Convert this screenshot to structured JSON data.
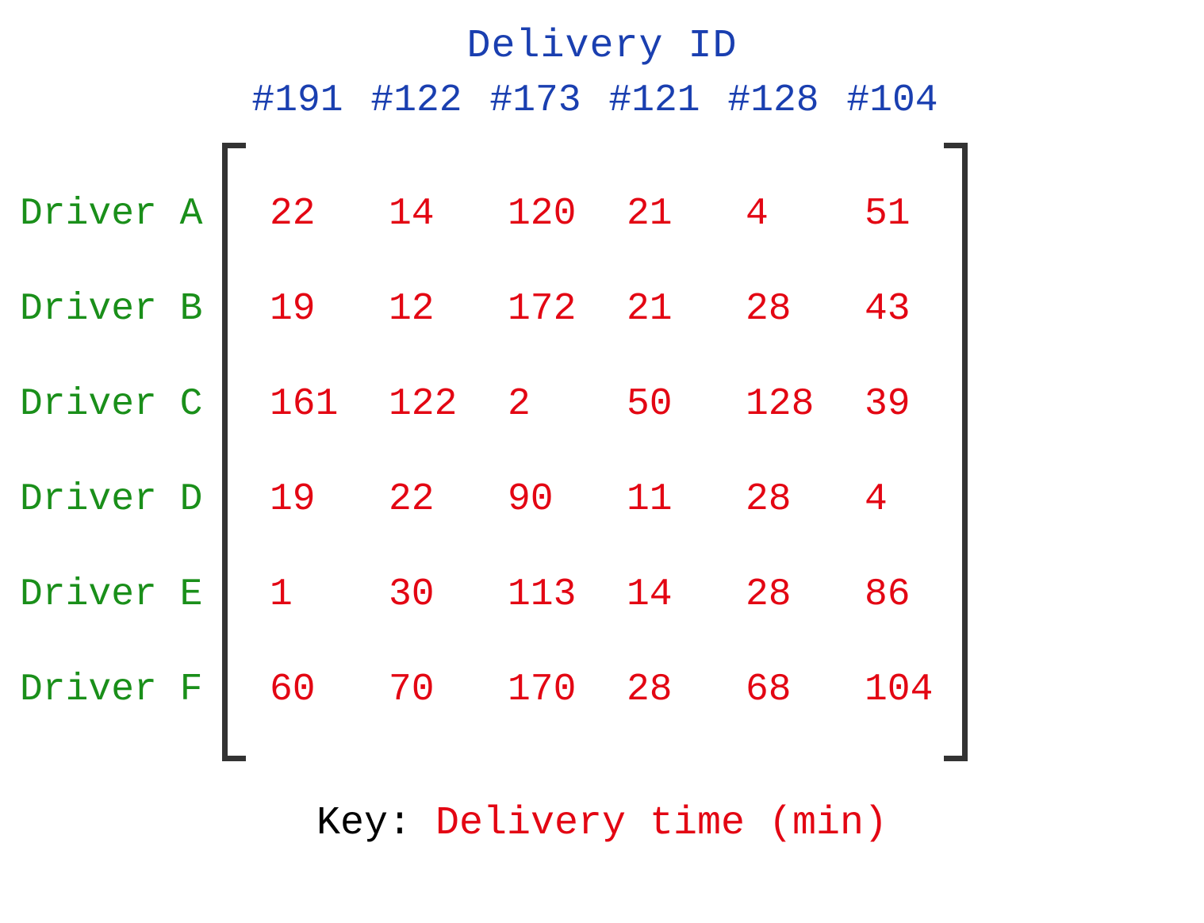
{
  "chart_data": {
    "type": "table",
    "title": "Delivery ID",
    "row_label_title": "",
    "columns": [
      "#191",
      "#122",
      "#173",
      "#121",
      "#128",
      "#104"
    ],
    "rows": [
      "Driver A",
      "Driver B",
      "Driver C",
      "Driver D",
      "Driver E",
      "Driver F"
    ],
    "values": [
      [
        22,
        14,
        120,
        21,
        4,
        51
      ],
      [
        19,
        12,
        172,
        21,
        28,
        43
      ],
      [
        161,
        122,
        2,
        50,
        128,
        39
      ],
      [
        19,
        22,
        90,
        11,
        28,
        4
      ],
      [
        1,
        30,
        113,
        14,
        28,
        86
      ],
      [
        60,
        70,
        170,
        28,
        68,
        104
      ]
    ],
    "key_label": "Key: ",
    "key_value_label": "Delivery time (min)"
  }
}
